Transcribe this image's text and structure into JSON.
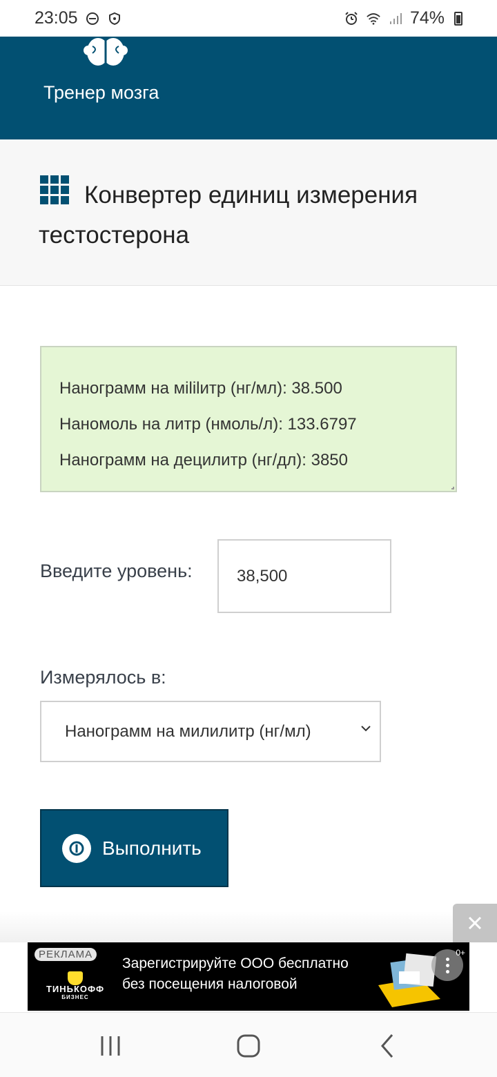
{
  "status_bar": {
    "time": "23:05",
    "battery": "74%",
    "icons": [
      "do-not-disturb-icon",
      "vpn-shield-icon",
      "alarm-icon",
      "wifi-icon",
      "signal-icon",
      "battery-icon"
    ]
  },
  "header": {
    "app_title": "Тренер мозга",
    "logo_icon": "brain-icon",
    "background_color": "#025072"
  },
  "page": {
    "title": "Конвертер единиц измерения тестостерона",
    "title_icon": "grid-icon"
  },
  "results": {
    "lines": [
      "Нанограмм на мililитр (нг/мл): 38.500",
      "Наномоль на литр (нмоль/л): 133.6797",
      "Нанограмм на децилитр (нг/дл): 3850"
    ],
    "background_color": "#e5f6d5"
  },
  "form": {
    "level_label": "Введите уровень:",
    "level_value": "38,500",
    "measured_label": "Измерялось в:",
    "unit_selected": "Нанограмм на милилитр (нг/мл)",
    "submit_label": "Выполнить"
  },
  "ad": {
    "tag": "РЕКЛАМА",
    "brand": "ТИНЬКОФФ",
    "brand_sub": "БИЗНЕС",
    "text_line1": "Зарегистрируйте ООО бесплатно",
    "text_line2": "без посещения налоговой",
    "age": "0+"
  },
  "nav": {
    "icons": [
      "recent-apps-icon",
      "home-icon",
      "back-icon"
    ]
  }
}
